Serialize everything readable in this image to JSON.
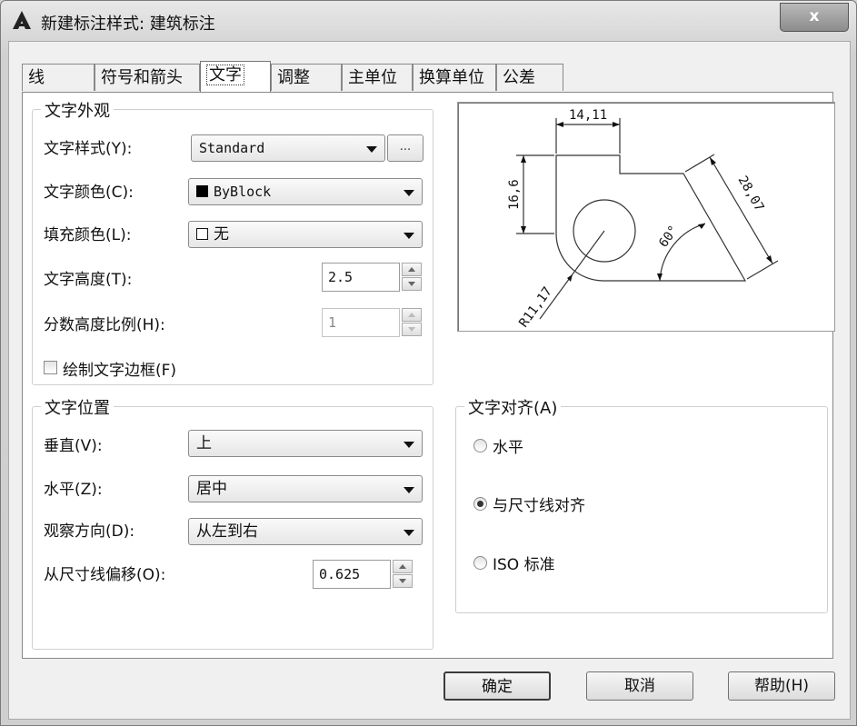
{
  "window": {
    "title": "新建标注样式: 建筑标注",
    "close_label": "x"
  },
  "tabs": [
    {
      "label": "线"
    },
    {
      "label": "符号和箭头"
    },
    {
      "label": "文字"
    },
    {
      "label": "调整"
    },
    {
      "label": "主单位"
    },
    {
      "label": "换算单位"
    },
    {
      "label": "公差"
    }
  ],
  "appearance": {
    "legend": "文字外观",
    "text_style_label": "文字样式(Y):",
    "text_style_value": "Standard",
    "dots_label": "...",
    "text_color_label": "文字颜色(C):",
    "text_color_value": "ByBlock",
    "fill_color_label": "填充颜色(L):",
    "fill_color_value": "无",
    "text_height_label": "文字高度(T):",
    "text_height_value": "2.5",
    "fraction_scale_label": "分数高度比例(H):",
    "fraction_scale_value": "1",
    "draw_frame_label": "绘制文字边框(F)"
  },
  "placement": {
    "legend": "文字位置",
    "vertical_label": "垂直(V):",
    "vertical_value": "上",
    "horizontal_label": "水平(Z):",
    "horizontal_value": "居中",
    "view_dir_label": "观察方向(D):",
    "view_dir_value": "从左到右",
    "offset_label": "从尺寸线偏移(O):",
    "offset_value": "0.625"
  },
  "alignment": {
    "legend": "文字对齐(A)",
    "opt_horizontal": "水平",
    "opt_aligned": "与尺寸线对齐",
    "opt_iso": "ISO 标准",
    "selected": "与尺寸线对齐"
  },
  "preview": {
    "dim_top": "14,11",
    "dim_left": "16,6",
    "dim_right": "28,07",
    "dim_angle": "60°",
    "dim_radius": "R11,17"
  },
  "buttons": {
    "ok": "确定",
    "cancel": "取消",
    "help": "帮助(H)"
  }
}
